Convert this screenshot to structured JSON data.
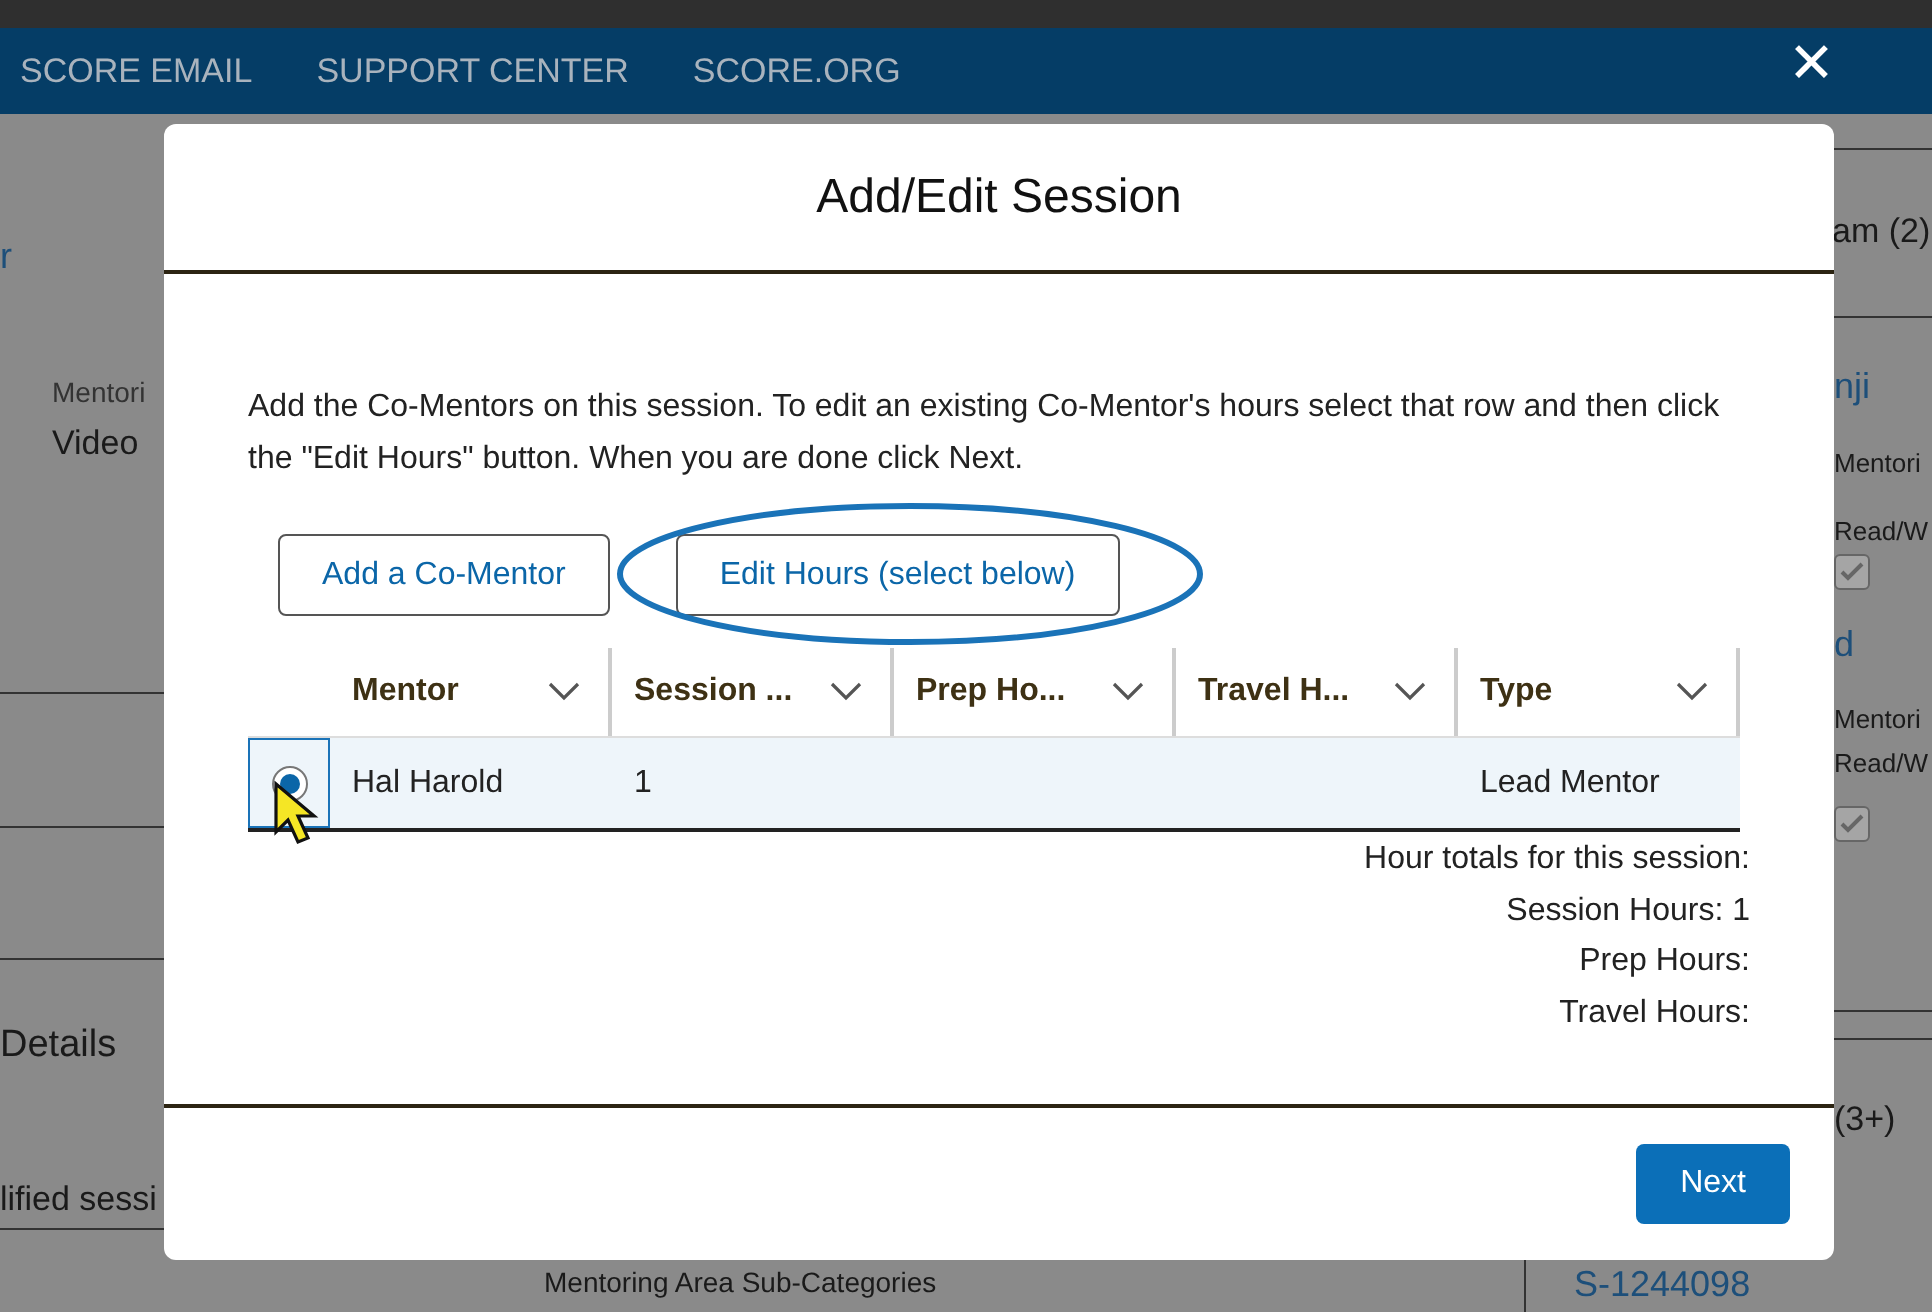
{
  "nav": {
    "items": [
      "SCORE EMAIL",
      "SUPPORT CENTER",
      "SCORE.ORG"
    ],
    "close": "✕"
  },
  "background": {
    "left": [
      {
        "kind": "link",
        "text": "r"
      },
      {
        "kind": "label",
        "text": "Mentori"
      },
      {
        "kind": "value",
        "text": "Video"
      },
      {
        "kind": "heading",
        "text": "Details"
      },
      {
        "kind": "value",
        "text": "lified sessi"
      }
    ],
    "right": [
      {
        "kind": "heading",
        "text": "am (2)"
      },
      {
        "kind": "link",
        "text": "nji"
      },
      {
        "kind": "value",
        "text": "Mentori"
      },
      {
        "kind": "value",
        "text": "Read/W"
      },
      {
        "kind": "checkbox",
        "checked": true
      },
      {
        "kind": "link",
        "text": "d"
      },
      {
        "kind": "value",
        "text": "Mentori"
      },
      {
        "kind": "value",
        "text": "Read/W"
      },
      {
        "kind": "checkbox",
        "checked": true
      },
      {
        "kind": "heading",
        "text": "(3+)"
      },
      {
        "kind": "link",
        "text": "S-1244098"
      }
    ],
    "bottom": "Mentoring Area Sub-Categories"
  },
  "dialog": {
    "title": "Add/Edit Session",
    "instructions": "Add the Co-Mentors on this session. To edit an existing Co-Mentor's hours select that row and then click the \"Edit Hours\" button. When you are done click Next.",
    "buttons": [
      {
        "label": "Add a Co-Mentor",
        "highlighted": false
      },
      {
        "label": "Edit Hours (select below)",
        "highlighted": true
      }
    ],
    "table": {
      "columns": [
        "Mentor",
        "Session ...",
        "Prep Ho...",
        "Travel H...",
        "Type"
      ],
      "rows": [
        {
          "selected": true,
          "cells": [
            "Hal Harold",
            "1",
            "",
            "",
            "Lead Mentor"
          ]
        }
      ]
    },
    "totals": [
      "Hour totals for this session:",
      "Session Hours: 1",
      "Prep Hours:",
      "Travel Hours:"
    ],
    "next": "Next"
  }
}
